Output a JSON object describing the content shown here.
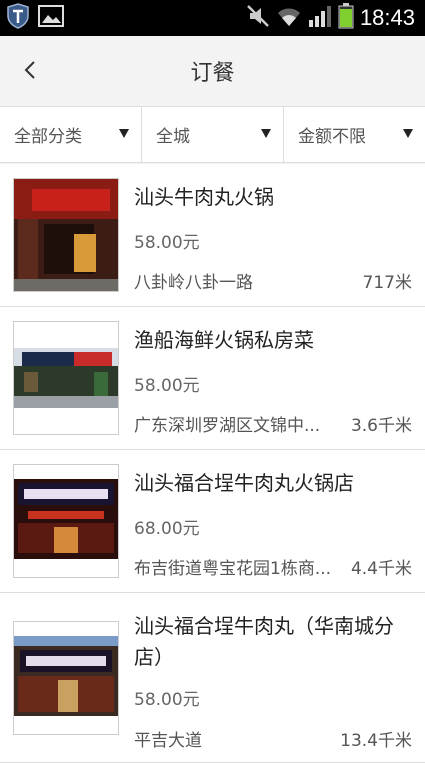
{
  "status_bar": {
    "time": "18:43",
    "icons": [
      "shield-icon",
      "gallery-icon",
      "mute-icon",
      "wifi-icon",
      "signal-icon",
      "battery-icon"
    ]
  },
  "header": {
    "title": "订餐",
    "back_icon": "chevron-left-icon"
  },
  "filters": [
    {
      "label": "全部分类"
    },
    {
      "label": "全城"
    },
    {
      "label": "金额不限"
    }
  ],
  "restaurants": [
    {
      "name": "汕头牛肉丸火锅",
      "price": "58.00元",
      "address": "八卦岭八卦一路",
      "distance": "717米"
    },
    {
      "name": "渔船海鲜火锅私房菜",
      "price": "58.00元",
      "address": "广东深圳罗湖区文锦中...",
      "distance": "3.6千米"
    },
    {
      "name": "汕头福合埕牛肉丸火锅店",
      "price": "68.00元",
      "address": "布吉街道粤宝花园1栋商...",
      "distance": "4.4千米"
    },
    {
      "name": "汕头福合埕牛肉丸（华南城分店）",
      "price": "58.00元",
      "address": "平吉大道",
      "distance": "13.4千米"
    }
  ],
  "colors": {
    "status_bar": "#000000",
    "header_bg": "#f3f3f3",
    "battery": "#7fd02f"
  }
}
